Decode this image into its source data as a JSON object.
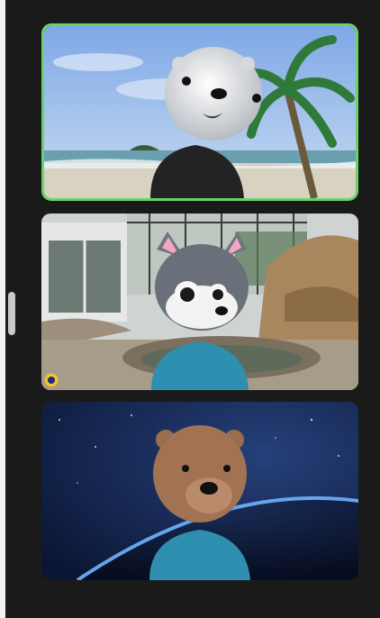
{
  "participants": [
    {
      "avatar": "otter-avatar",
      "background": "beach-background",
      "speaking": true
    },
    {
      "avatar": "wolf-avatar",
      "background": "zoo-enclosure-background",
      "speaking": false
    },
    {
      "avatar": "bear-avatar",
      "background": "space-earth-background",
      "speaking": false
    }
  ],
  "colors": {
    "active_speaker_border": "#6bd26b",
    "panel_background": "#1a1a1a"
  }
}
